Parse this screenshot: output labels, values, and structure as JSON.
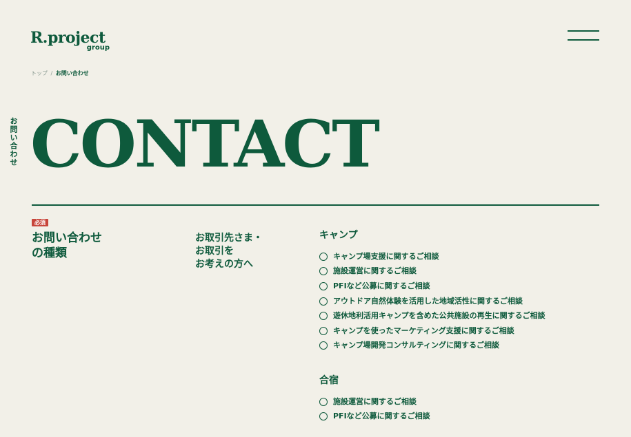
{
  "header": {
    "logo_main": "R.project",
    "logo_sub": "group",
    "menu_icon": "hamburger-icon"
  },
  "breadcrumb": {
    "home": "トップ",
    "separator": "/",
    "current": "お問い合わせ"
  },
  "page": {
    "vertical_label": "お問い合わせ",
    "title": "CONTACT"
  },
  "form": {
    "required_badge": "必須",
    "field_label": [
      "お問い合わせ",
      "の種類"
    ],
    "audience_label": [
      "お取引先さま・",
      "お取引を",
      "お考えの方へ"
    ],
    "groups": [
      {
        "title": "キャンプ",
        "options": [
          "キャンプ場支援に関するご相談",
          "施設運営に関するご相談",
          "PFIなど公募に関するご相談",
          "アウトドア自然体験を活用した地域活性に関するご相談",
          "遊休地利活用キャンプを含めた公共施設の再生に関するご相談",
          "キャンプを使ったマーケティング支援に関するご相談",
          "キャンプ場開発コンサルティングに関するご相談"
        ]
      },
      {
        "title": "合宿",
        "options": [
          "施設運営に関するご相談",
          "PFIなど公募に関するご相談"
        ]
      }
    ]
  },
  "colors": {
    "background": "#f2f0e8",
    "brand_green": "#0e5a3c",
    "required_red": "#c7453a"
  }
}
